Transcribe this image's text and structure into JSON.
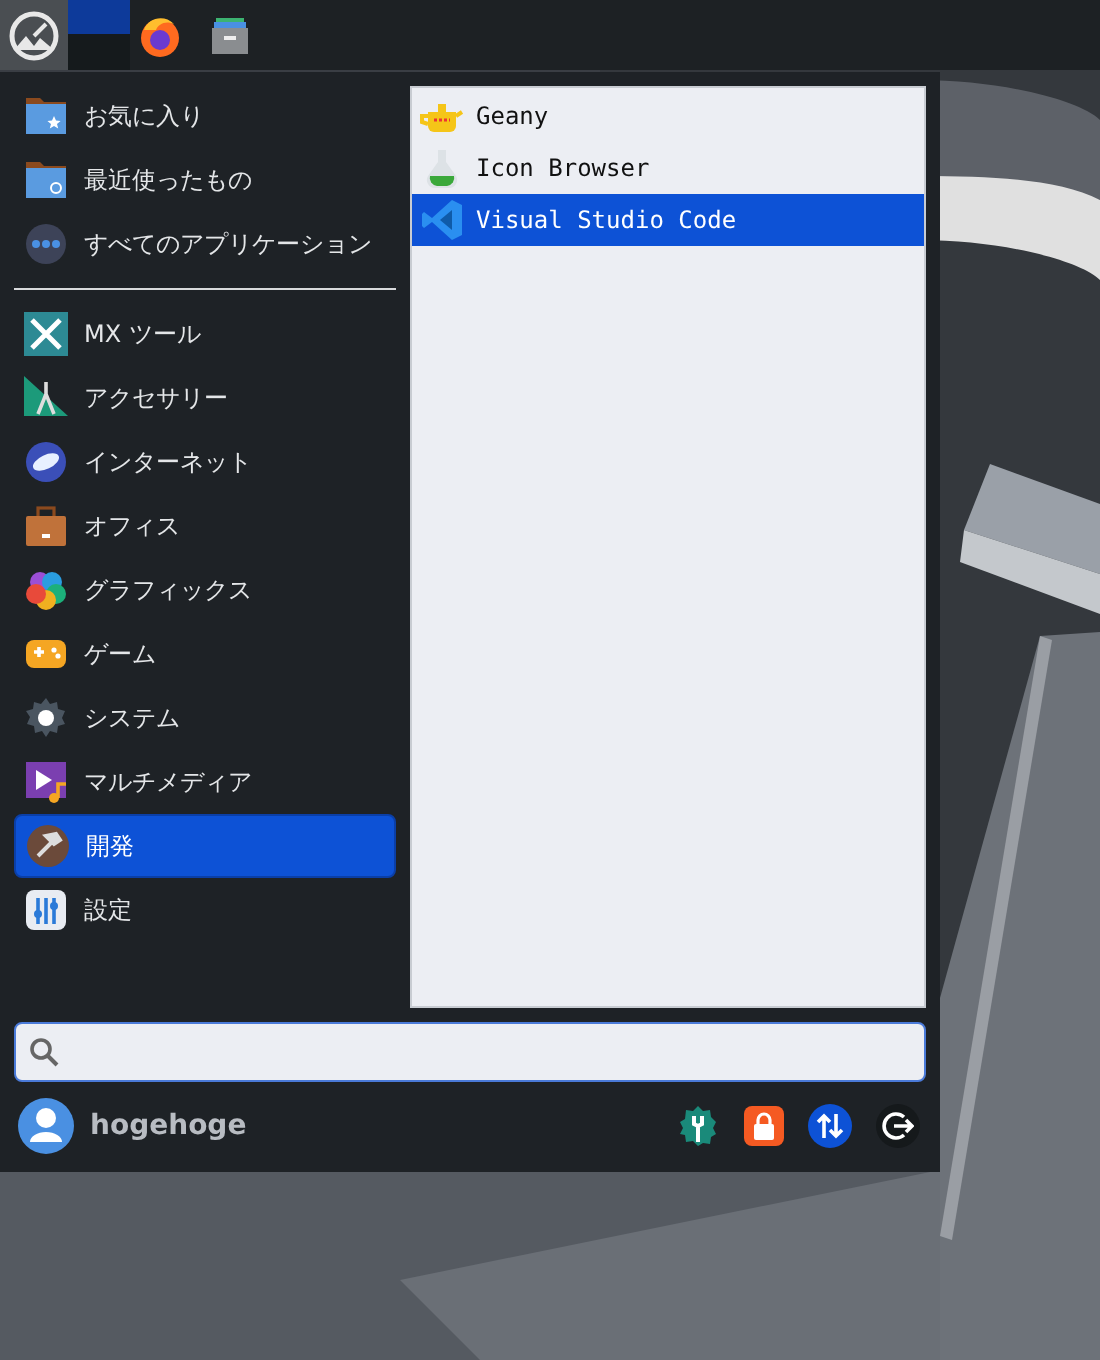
{
  "places": [
    {
      "label": "お気に入り"
    },
    {
      "label": "最近使ったもの"
    },
    {
      "label": "すべてのアプリケーション"
    }
  ],
  "categories": [
    {
      "label": "MX ツール",
      "selected": false
    },
    {
      "label": "アクセサリー",
      "selected": false
    },
    {
      "label": "インターネット",
      "selected": false
    },
    {
      "label": "オフィス",
      "selected": false
    },
    {
      "label": "グラフィックス",
      "selected": false
    },
    {
      "label": "ゲーム",
      "selected": false
    },
    {
      "label": "システム",
      "selected": false
    },
    {
      "label": "マルチメディア",
      "selected": false
    },
    {
      "label": "開発",
      "selected": true
    },
    {
      "label": "設定",
      "selected": false
    }
  ],
  "apps": [
    {
      "label": "Geany",
      "selected": false
    },
    {
      "label": "Icon Browser",
      "selected": false
    },
    {
      "label": "Visual Studio Code",
      "selected": true
    }
  ],
  "user": {
    "name": "hogehoge"
  }
}
